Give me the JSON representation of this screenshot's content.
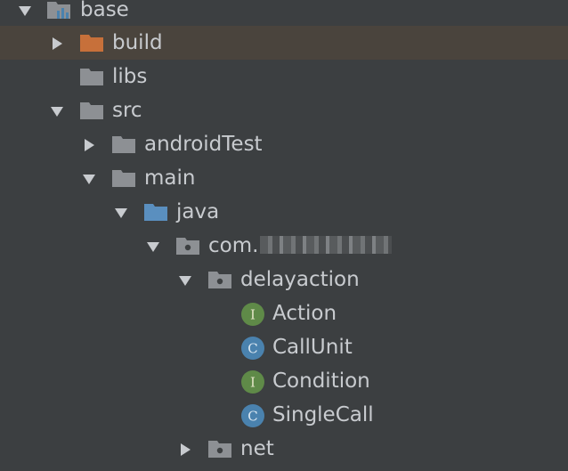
{
  "colors": {
    "background": "#3c3f41",
    "selected_row": "#4a443d",
    "text": "#c8cbcf",
    "folder_gray": "#8d9094",
    "folder_orange": "#c7703a",
    "folder_blue": "#5a8fbf",
    "interface_badge": "#5f8a48",
    "class_badge": "#4a82ae"
  },
  "tree": {
    "base": {
      "label": "base",
      "icon": "module-icon",
      "expanded": true
    },
    "build": {
      "label": "build",
      "icon": "excluded-folder-icon",
      "expanded": false,
      "selected": true
    },
    "libs": {
      "label": "libs",
      "icon": "folder-icon"
    },
    "src": {
      "label": "src",
      "icon": "folder-icon",
      "expanded": true
    },
    "androidTest": {
      "label": "androidTest",
      "icon": "folder-icon",
      "expanded": false
    },
    "main": {
      "label": "main",
      "icon": "folder-icon",
      "expanded": true
    },
    "java": {
      "label": "java",
      "icon": "source-folder-icon",
      "expanded": true
    },
    "com_pkg": {
      "label": "com.",
      "icon": "package-icon",
      "expanded": true,
      "redacted": true
    },
    "delayaction": {
      "label": "delayaction",
      "icon": "package-icon",
      "expanded": true
    },
    "action": {
      "label": "Action",
      "badge": "I",
      "kind": "interface"
    },
    "callunit": {
      "label": "CallUnit",
      "badge": "C",
      "kind": "class"
    },
    "condition": {
      "label": "Condition",
      "badge": "I",
      "kind": "interface"
    },
    "singlecall": {
      "label": "SingleCall",
      "badge": "C",
      "kind": "class"
    },
    "net": {
      "label": "net",
      "icon": "package-icon",
      "expanded": false
    }
  }
}
